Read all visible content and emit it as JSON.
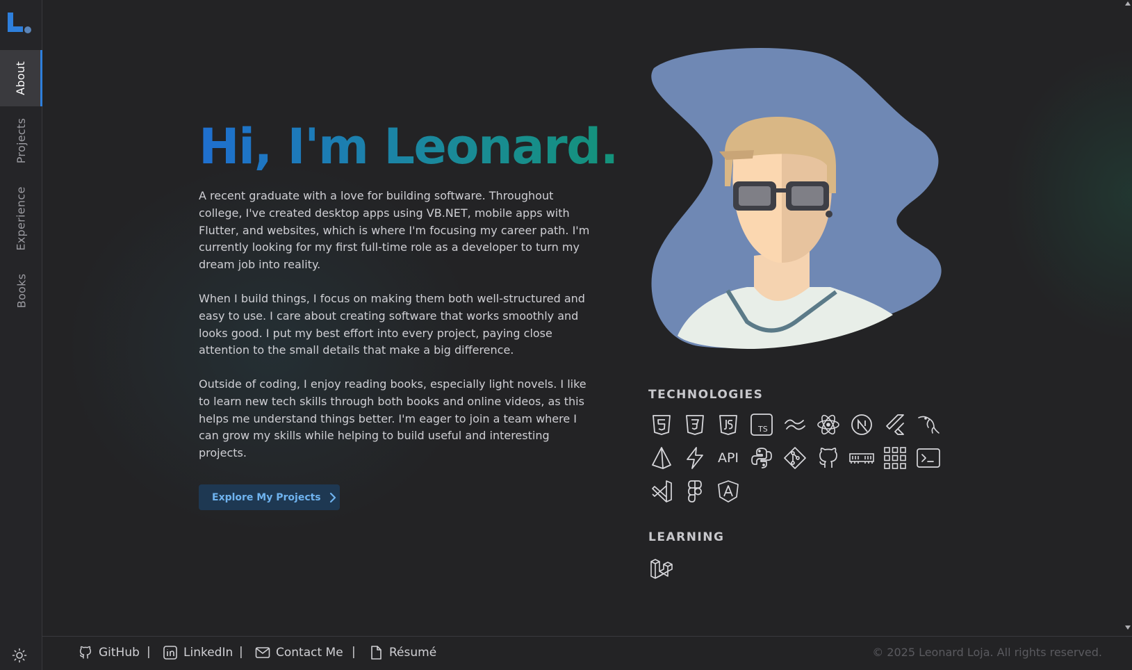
{
  "app": {
    "logo_letter": "L"
  },
  "sidebar": {
    "items": [
      {
        "label": "About",
        "active": true
      },
      {
        "label": "Projects",
        "active": false
      },
      {
        "label": "Experience",
        "active": false
      },
      {
        "label": "Books",
        "active": false
      }
    ],
    "theme_toggle_icon": "sun-icon"
  },
  "hero": {
    "title": "Hi, I'm Leonard.",
    "paragraphs": [
      "A recent graduate with a love for building software. Throughout college, I've created desktop apps using VB.NET, mobile apps with Flutter, and websites, which is where I'm focusing my career path. I'm currently looking for my first full-time role as a developer to turn my dream job into reality.",
      "When I build things, I focus on making them both well-structured and easy to use. I care about creating software that works smoothly and looks good. I put my best effort into every project, paying close attention to the small details that make a big difference.",
      "Outside of coding, I enjoy reading books, especially light novels. I like to learn new tech skills through both books and online videos, as this helps me understand things better. I'm eager to join a team where I can grow my skills while helping to build useful and interesting projects."
    ],
    "cta_label": "Explore My Projects",
    "cta_icon": "chevron-right-icon"
  },
  "technologies": {
    "heading": "TECHNOLOGIES",
    "icons": [
      "html5-icon",
      "css3-icon",
      "javascript-icon",
      "typescript-icon",
      "tailwind-icon",
      "react-icon",
      "nextjs-icon",
      "flutter-icon",
      "mysql-icon",
      "prisma-icon",
      "zap-icon",
      "api-icon",
      "python-icon",
      "git-icon",
      "github-icon",
      "ram-icon",
      "grid-icon",
      "terminal-icon",
      "vscode-icon",
      "figma-icon",
      "angular-icon"
    ],
    "api_text": "API",
    "ts_text": "TS"
  },
  "learning": {
    "heading": "LEARNING",
    "icons": [
      "laravel-icon"
    ]
  },
  "footer": {
    "links": [
      {
        "label": "GitHub",
        "icon": "github-icon"
      },
      {
        "label": "LinkedIn",
        "icon": "linkedin-icon"
      },
      {
        "label": "Contact Me",
        "icon": "mail-icon"
      },
      {
        "label": "Résumé",
        "icon": "file-icon"
      }
    ],
    "separator": "|",
    "copyright": "© 2025 Leonard Loja. All rights reserved."
  },
  "colors": {
    "accent_blue": "#2e7fdc",
    "title_gradient_start": "#1f6fd0",
    "title_gradient_end": "#14927a",
    "background": "#232325",
    "button_bg": "#1e3852",
    "button_text": "#6fb3ef"
  }
}
